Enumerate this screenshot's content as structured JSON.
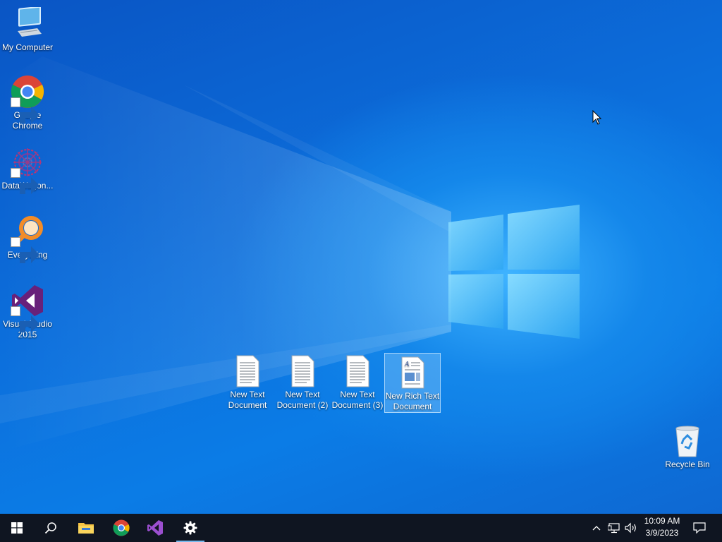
{
  "desktop": {
    "icons": [
      {
        "label": "My Computer",
        "icon": "computer-icon"
      },
      {
        "label": "Google Chrome",
        "icon": "chrome-icon"
      },
      {
        "label": "DataWagon...",
        "icon": "datawagon-icon"
      },
      {
        "label": "Everything",
        "icon": "everything-icon"
      },
      {
        "label": "Visual Studio 2015",
        "icon": "visual-studio-icon"
      },
      {
        "label": "New Text Document",
        "icon": "text-document-icon"
      },
      {
        "label": "New Text Document (2)",
        "icon": "text-document-icon"
      },
      {
        "label": "New Text Document (3)",
        "icon": "text-document-icon"
      },
      {
        "label": "New Rich Text Document",
        "icon": "rich-text-document-icon",
        "selected": true
      },
      {
        "label": "Recycle Bin",
        "icon": "recycle-bin-icon"
      }
    ]
  },
  "taskbar": {
    "items": [
      {
        "name": "start",
        "icon": "windows-start-icon"
      },
      {
        "name": "search",
        "icon": "search-icon"
      },
      {
        "name": "file-explorer",
        "icon": "folder-icon"
      },
      {
        "name": "google-chrome",
        "icon": "chrome-icon"
      },
      {
        "name": "visual-studio",
        "icon": "visual-studio-icon"
      },
      {
        "name": "settings",
        "icon": "gear-icon",
        "active": true
      }
    ],
    "tray": {
      "icons": [
        "chevron-up-icon",
        "network-icon",
        "volume-icon"
      ],
      "time": "10:09 AM",
      "date": "3/9/2023",
      "notification_icon": "notification-icon"
    }
  },
  "colors": {
    "taskbar_bg": "#0f1521",
    "active_indicator": "#76b9ed",
    "desktop_blue": "#0b6fdc"
  }
}
